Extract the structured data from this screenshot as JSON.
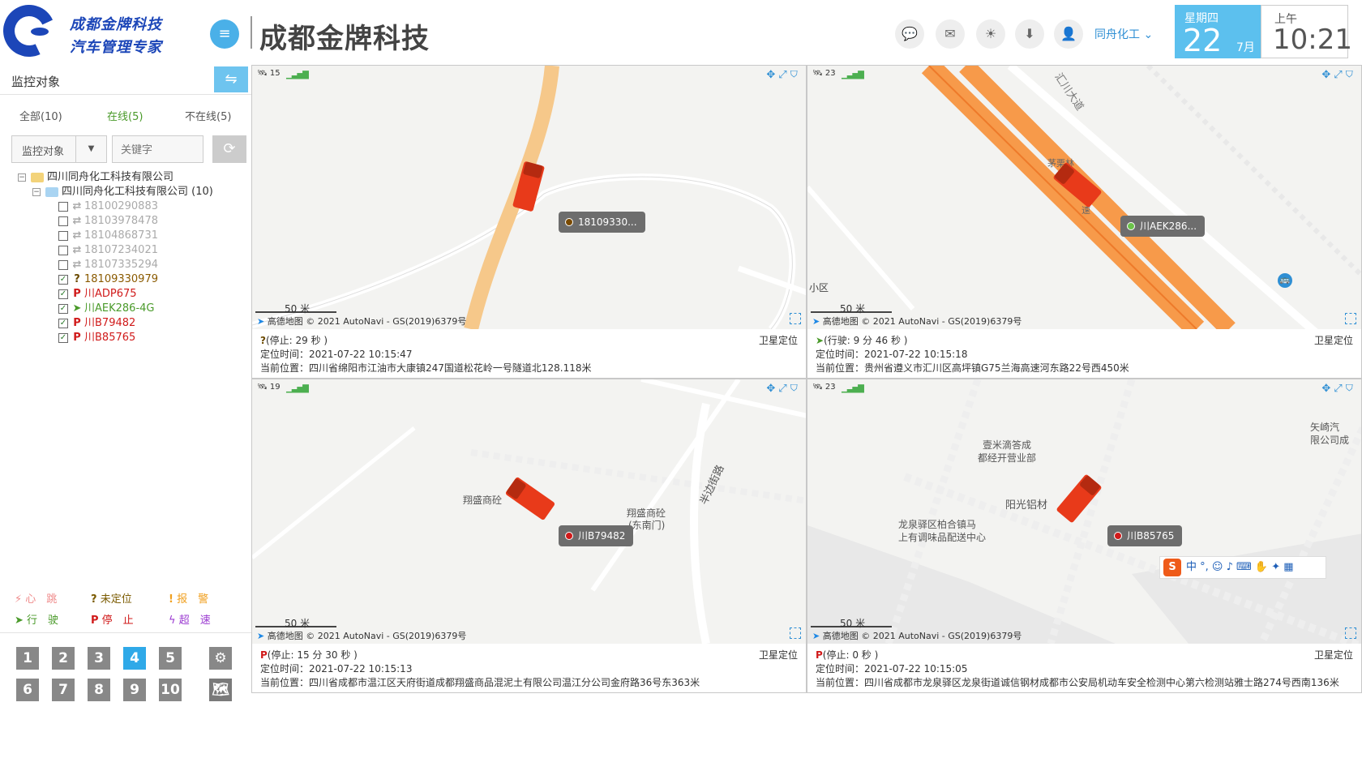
{
  "brand": {
    "line1": "成都金牌科技",
    "line2": "汽车管理专家"
  },
  "app_title": "成都金牌科技",
  "header": {
    "user": "同舟化工",
    "weekday": "星期四",
    "day": "22",
    "month": "7月",
    "ampm": "上午",
    "time": "10:21"
  },
  "sidebar": {
    "title": "监控对象",
    "tabs": {
      "all": "全部(10)",
      "online": "在线(5)",
      "offline": "不在线(5)"
    },
    "select_value": "监控对象",
    "keyword_placeholder": "关键字",
    "tree": {
      "root": "四川同舟化工科技有限公司",
      "child": "四川同舟化工科技有限公司 (10)",
      "vehicles": [
        {
          "name": "18100290883",
          "status_icon": "offline",
          "checked": false
        },
        {
          "name": "18103978478",
          "status_icon": "offline",
          "checked": false
        },
        {
          "name": "18104868731",
          "status_icon": "offline",
          "checked": false
        },
        {
          "name": "18107234021",
          "status_icon": "offline",
          "checked": false
        },
        {
          "name": "18107335294",
          "status_icon": "offline",
          "checked": false
        },
        {
          "name": "18109330979",
          "status_icon": "unlocated",
          "checked": true
        },
        {
          "name": "川ADP675",
          "status_icon": "parked",
          "checked": true
        },
        {
          "name": "川AEK286-4G",
          "status_icon": "moving",
          "checked": true
        },
        {
          "name": "川B79482",
          "status_icon": "parked",
          "checked": true
        },
        {
          "name": "川B85765",
          "status_icon": "parked",
          "checked": true
        }
      ]
    },
    "legend": {
      "heartbeat": "心　跳",
      "unlocated": "未定位",
      "alarm": "报　警",
      "moving": "行　驶",
      "stopped": "停　止",
      "speeding": "超　速"
    },
    "layouts": [
      "1",
      "2",
      "3",
      "4",
      "5",
      "6",
      "7",
      "8",
      "9",
      "10"
    ],
    "active_layout": "4"
  },
  "panels": [
    {
      "sat_count": "15",
      "label": "18109330...",
      "scale": "50 米",
      "amap": "高德地图",
      "copyright": "© 2021 AutoNavi - GS(2019)6379号",
      "status_icon": "?",
      "status": "(停止: 29 秒 )",
      "loc_type": "卫星定位",
      "time_line": "定位时间：2021-07-22 10:15:47",
      "addr_line": "当前位置：四川省绵阳市江油市大康镇247国道松花岭一号隧道北128.118米",
      "map_texts": []
    },
    {
      "sat_count": "23",
      "label": "川AEK286...",
      "scale": "50 米",
      "amap": "高德地图",
      "copyright": "© 2021 AutoNavi - GS(2019)6379号",
      "status_icon": "➤",
      "status": "(行驶: 9 分 46 秒 )",
      "loc_type": "卫星定位",
      "time_line": "定位时间：2021-07-22 10:15:18",
      "addr_line": "当前位置：贵州省遵义市汇川区高坪镇G75兰海高速河东路22号西450米",
      "map_texts": [
        "汇川大道",
        "茅栗林",
        "速",
        "小区"
      ]
    },
    {
      "sat_count": "19",
      "label": "川B79482",
      "scale": "50 米",
      "amap": "高德地图",
      "copyright": "© 2021 AutoNavi - GS(2019)6379号",
      "status_icon": "P",
      "status": "(停止: 15 分 30 秒 )",
      "loc_type": "卫星定位",
      "time_line": "定位时间：2021-07-22 10:15:13",
      "addr_line": "当前位置：四川省成都市温江区天府街道成都翔盛商品混泥土有限公司温江分公司金府路36号东363米",
      "map_texts": [
        "翔盛商砼",
        "翔盛商砼",
        "(东南门)",
        "半边街路"
      ]
    },
    {
      "sat_count": "23",
      "label": "川B85765",
      "scale": "50 米",
      "amap": "高德地图",
      "copyright": "© 2021 AutoNavi - GS(2019)6379号",
      "status_icon": "P",
      "status": "(停止: 0 秒 )",
      "loc_type": "卫星定位",
      "time_line": "定位时间：2021-07-22 10:15:05",
      "addr_line": "当前位置：四川省成都市龙泉驿区龙泉街道诚信钢材成都市公安局机动车安全检测中心第六检测站雅士路274号西南136米",
      "map_texts": [
        "壹米滴答成",
        "都经开营业部",
        "阳光铝材",
        "龙泉驿区柏合镇马",
        "上有调味品配送中心",
        "矢崎汽",
        "限公司成"
      ]
    }
  ],
  "ime": "中 °, ☺ ♪ ⌨ ✋ ✦ ▦",
  "colors": {
    "accent": "#2fa9e8",
    "brand": "#1c46b8",
    "truck": "#e83a1a"
  }
}
